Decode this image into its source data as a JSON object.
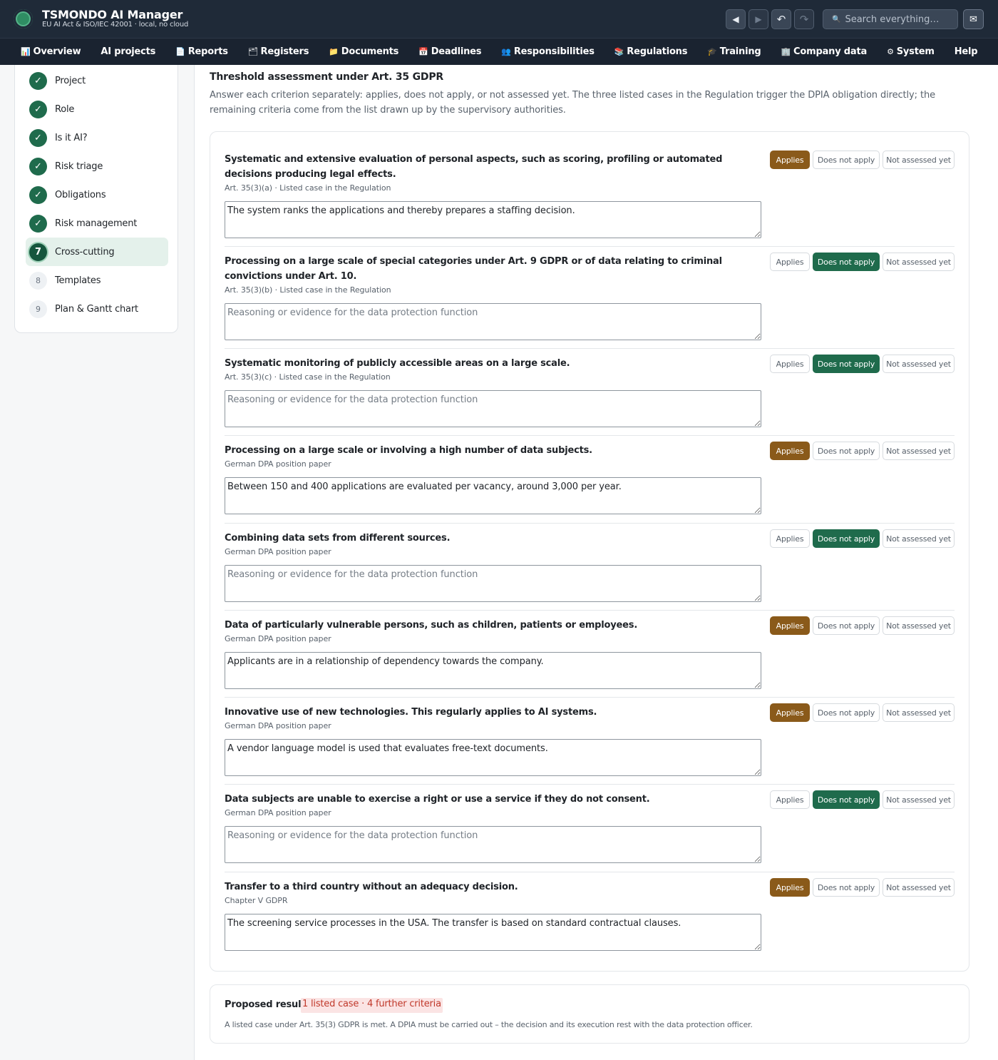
{
  "app": {
    "title": "TSMONDO AI Manager",
    "subtitle": "EU AI Act & ISO/IEC 42001 · local, no cloud",
    "search_placeholder": "Search everything…"
  },
  "header_icons": {
    "back": "◀",
    "forward": "▶",
    "undo": "↶",
    "redo": "↷",
    "search": "🔍",
    "mail": "✉"
  },
  "nav": [
    {
      "label": "Overview",
      "icon": "📊"
    },
    {
      "label": "AI projects",
      "icon": ""
    },
    {
      "label": "Reports",
      "icon": "📄"
    },
    {
      "label": "Registers",
      "icon": "🗂"
    },
    {
      "label": "Documents",
      "icon": "📁"
    },
    {
      "label": "Deadlines",
      "icon": "📅"
    },
    {
      "label": "Responsibilities",
      "icon": "👥"
    },
    {
      "label": "Regulations",
      "icon": "📚"
    },
    {
      "label": "Training",
      "icon": "🎓"
    },
    {
      "label": "Company data",
      "icon": "🏢"
    },
    {
      "label": "System",
      "icon": "⚙"
    },
    {
      "label": "Help",
      "icon": ""
    }
  ],
  "steps": [
    {
      "label": "Project",
      "badge": "✓",
      "state": "done"
    },
    {
      "label": "Role",
      "badge": "✓",
      "state": "done"
    },
    {
      "label": "Is it AI?",
      "badge": "✓",
      "state": "done"
    },
    {
      "label": "Risk triage",
      "badge": "✓",
      "state": "done"
    },
    {
      "label": "Obligations",
      "badge": "✓",
      "state": "done"
    },
    {
      "label": "Risk management",
      "badge": "✓",
      "state": "done"
    },
    {
      "label": "Cross-cutting",
      "badge": "7",
      "state": "active"
    },
    {
      "label": "Templates",
      "badge": "8",
      "state": "todo"
    },
    {
      "label": "Plan & Gantt chart",
      "badge": "9",
      "state": "todo"
    }
  ],
  "section": {
    "title": "Threshold assessment under Art. 35 GDPR",
    "description": "Answer each criterion separately: applies, does not apply, or not assessed yet. The three listed cases in the Regulation trigger the DPIA obligation directly; the remaining criteria come from the list drawn up by the supervisory authorities."
  },
  "options": {
    "applies": "Applies",
    "not_apply": "Does not apply",
    "not_yet": "Not assessed yet"
  },
  "placeholder": "Reasoning or evidence for the data protection function",
  "criteria": [
    {
      "text": "Systematic and extensive evaluation of personal aspects, such as scoring, profiling or automated decisions producing legal effects.",
      "ref": "Art. 35(3)(a) · Listed case in the Regulation",
      "value": "The system ranks the applications and thereby prepares a staffing decision.",
      "selected": "applies"
    },
    {
      "text": "Processing on a large scale of special categories under Art. 9 GDPR or of data relating to criminal convictions under Art. 10.",
      "ref": "Art. 35(3)(b) · Listed case in the Regulation",
      "value": "",
      "selected": "not_apply"
    },
    {
      "text": "Systematic monitoring of publicly accessible areas on a large scale.",
      "ref": "Art. 35(3)(c) · Listed case in the Regulation",
      "value": "",
      "selected": "not_apply"
    },
    {
      "text": "Processing on a large scale or involving a high number of data subjects.",
      "ref": "German DPA position paper",
      "value": "Between 150 and 400 applications are evaluated per vacancy, around 3,000 per year.",
      "selected": "applies"
    },
    {
      "text": "Combining data sets from different sources.",
      "ref": "German DPA position paper",
      "value": "",
      "selected": "not_apply"
    },
    {
      "text": "Data of particularly vulnerable persons, such as children, patients or employees.",
      "ref": "German DPA position paper",
      "value": "Applicants are in a relationship of dependency towards the company.",
      "selected": "applies"
    },
    {
      "text": "Innovative use of new technologies. This regularly applies to AI systems.",
      "ref": "German DPA position paper",
      "value": "A vendor language model is used that evaluates free-text documents.",
      "selected": "applies"
    },
    {
      "text": "Data subjects are unable to exercise a right or use a service if they do not consent.",
      "ref": "German DPA position paper",
      "value": "",
      "selected": "not_apply"
    },
    {
      "text": "Transfer to a third country without an adequacy decision.",
      "ref": "Chapter V GDPR",
      "value": "The screening service processes in the USA. The transfer is based on standard contractual clauses.",
      "selected": "applies"
    }
  ],
  "result": {
    "label": "Proposed result",
    "badge": "1 listed case · 4 further criteria",
    "text": "A listed case under Art. 35(3) GDPR is met. A DPIA must be carried out – the decision and its execution rest with the data protection officer."
  }
}
